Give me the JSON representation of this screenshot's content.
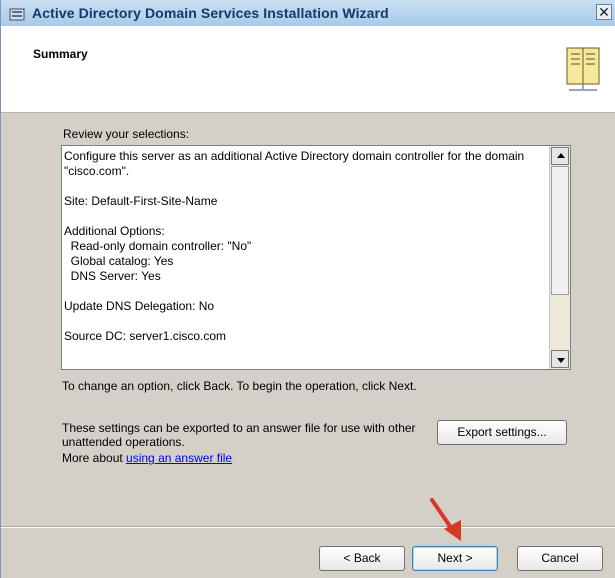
{
  "window": {
    "title": "Active Directory Domain Services Installation Wizard",
    "close_label": "✕"
  },
  "header": {
    "title": "Summary"
  },
  "content": {
    "review_label": "Review your selections:",
    "summary_text": "Configure this server as an additional Active Directory domain controller for the domain \"cisco.com\".\n\nSite: Default-First-Site-Name\n\nAdditional Options:\n  Read-only domain controller: \"No\"\n  Global catalog: Yes\n  DNS Server: Yes\n\nUpdate DNS Delegation: No\n\nSource DC: server1.cisco.com",
    "change_note": "To change an option, click Back. To begin the operation, click Next.",
    "export_note": "These settings can be exported to an answer file for use with other unattended operations.",
    "more_about_prefix": "More about ",
    "answer_file_link": "using an answer file",
    "export_button": "Export settings..."
  },
  "footer": {
    "back_button": "< Back",
    "next_button": "Next >",
    "cancel_button": "Cancel"
  }
}
